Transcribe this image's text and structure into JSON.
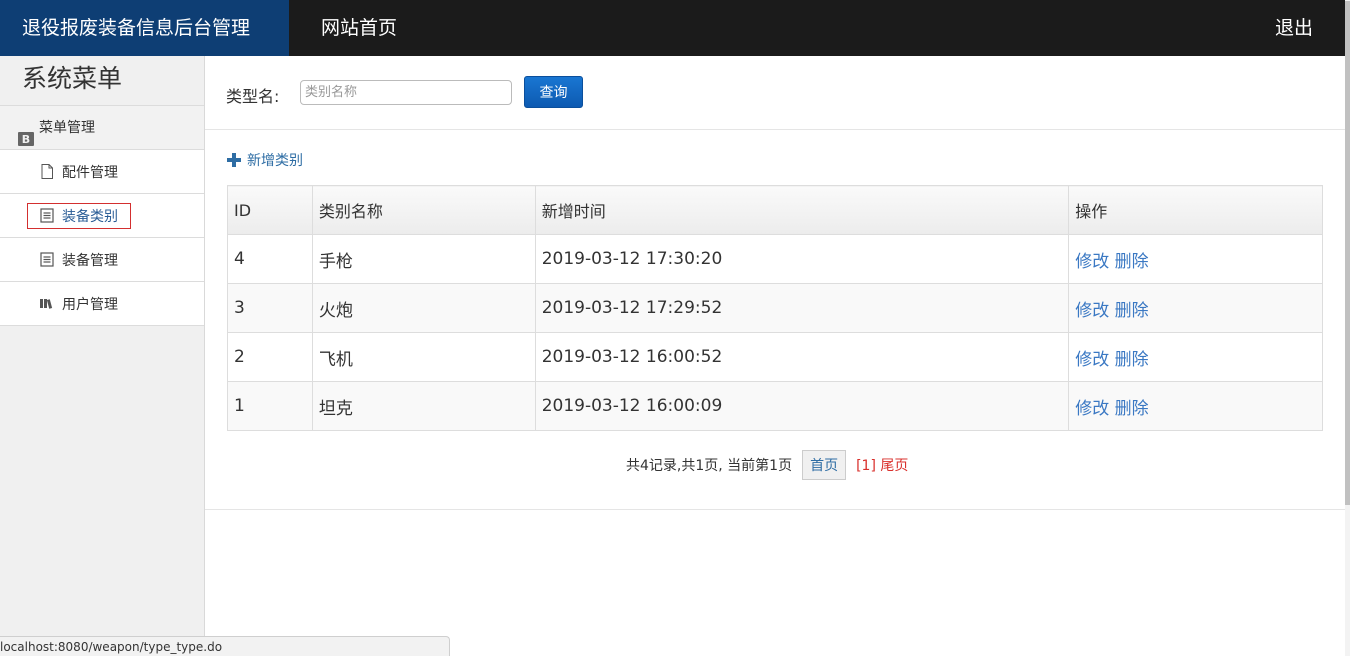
{
  "header": {
    "brand": "退役报废装备信息后台管理",
    "home": "网站首页",
    "logout": "退出"
  },
  "sidebar": {
    "title": "系统菜单",
    "group_label": "菜单管理",
    "group_icon": "bootstrap-icon",
    "items": [
      {
        "label": "配件管理",
        "icon": "file-icon"
      },
      {
        "label": "装备类别",
        "icon": "list-icon",
        "active": true
      },
      {
        "label": "装备管理",
        "icon": "list-icon"
      },
      {
        "label": "用户管理",
        "icon": "book-icon"
      }
    ]
  },
  "search": {
    "label": "类型名:",
    "placeholder": "类别名称",
    "value": "",
    "button": "查询"
  },
  "add_link": "新增类别",
  "table": {
    "headers": [
      "ID",
      "类别名称",
      "新增时间",
      "操作"
    ],
    "rows": [
      {
        "id": "4",
        "name": "手枪",
        "time": "2019-03-12 17:30:20",
        "edit": "修改",
        "delete": "删除"
      },
      {
        "id": "3",
        "name": "火炮",
        "time": "2019-03-12 17:29:52",
        "edit": "修改",
        "delete": "删除"
      },
      {
        "id": "2",
        "name": "飞机",
        "time": "2019-03-12 16:00:52",
        "edit": "修改",
        "delete": "删除"
      },
      {
        "id": "1",
        "name": "坦克",
        "time": "2019-03-12 16:00:09",
        "edit": "修改",
        "delete": "删除"
      }
    ]
  },
  "pager": {
    "summary": "共4记录,共1页, 当前第1页",
    "first": "首页",
    "pages": "[1] 尾页"
  },
  "status_url": "localhost:8080/weapon/type_type.do",
  "colors": {
    "brand_bg": "#0e3e74",
    "topbar_bg": "#1b1b1b",
    "link": "#3a78c3",
    "active_border": "#d32f2f"
  }
}
